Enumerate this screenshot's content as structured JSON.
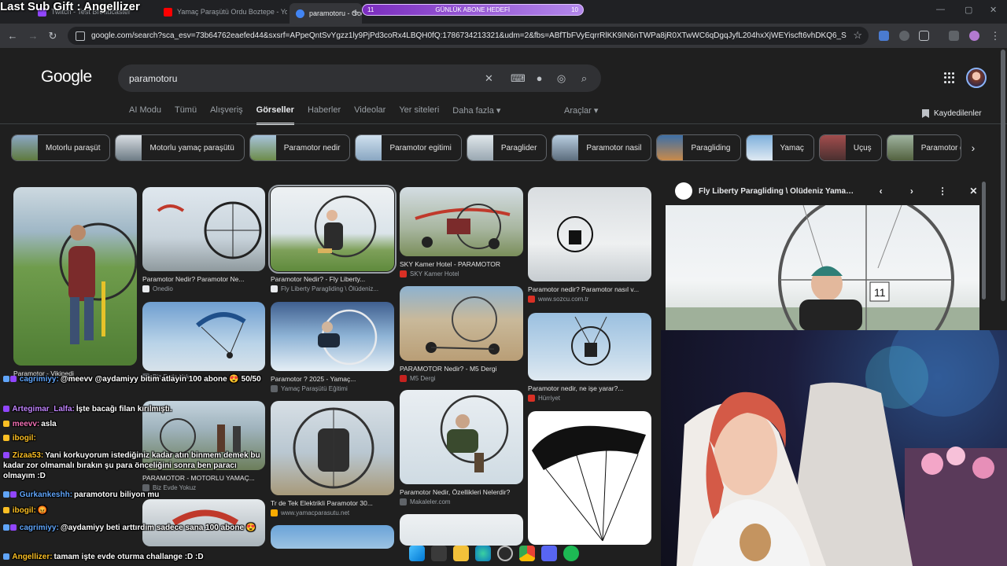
{
  "stream_overlay": {
    "title": "Last Sub Gift : Angellizer",
    "goal_label": "GÜNLÜK ABONE HEDEFİ",
    "goal_current": "11",
    "goal_target": "10"
  },
  "browser": {
    "tabs": [
      {
        "label": "Twitch - Test Broadcaster",
        "color": "#9146ff"
      },
      {
        "label": "Yamaç Paraşütü Ordu Boztepe - Yo",
        "color": "#ff0000"
      },
      {
        "label": "paramotoru - Google Görseller",
        "color": "#4285f4"
      }
    ],
    "close_glyph": "✕",
    "new_tab": "+",
    "url": "google.com/search?sca_esv=73b64762eaefed44&sxsrf=APpeQntSvYgzz1ly9PjPd3coRx4LBQH0fQ:1786734213321&udm=2&fbs=ABfTbFVyEqrrRlKK9IN6nTWPa8jR0XTwWC6qDgqJyfL204hxXjWEYiscft6vhDKQ6_S6oAF..."
  },
  "google": {
    "logo": "Google",
    "query": "paramotoru",
    "nav_tabs": [
      "AI Modu",
      "Tümü",
      "Alışveriş",
      "Görseller",
      "Haberler",
      "Videolar",
      "Yer siteleri",
      "Daha fazla ▾"
    ],
    "active_tab": "Görseller",
    "tools": "Araçlar ▾",
    "saved": "Kaydedilenler",
    "chips": [
      {
        "label": "Motorlu paraşüt",
        "color": "#6b7f55"
      },
      {
        "label": "Motorlu yamaç paraşütü",
        "color": "#8aa3b8"
      },
      {
        "label": "Paramotor nedir",
        "color": "#7e9ab5"
      },
      {
        "label": "Paramotor egitimi",
        "color": "#a9c1d8"
      },
      {
        "label": "Paraglider",
        "color": "#bcc8cf"
      },
      {
        "label": "Paramotor nasil",
        "color": "#8fa6b9"
      },
      {
        "label": "Paragliding",
        "color": "#5b7fa6"
      },
      {
        "label": "Yamaç",
        "color": "#8cb4d6"
      },
      {
        "label": "Uçuş",
        "color": "#7a4b4b"
      },
      {
        "label": "Paramotor g",
        "color": "#6f7d64"
      }
    ],
    "results": [
      {
        "caption": "Paramotor - Vikipedi",
        "source": "",
        "fav": "#ffffff"
      },
      {
        "caption": "Paramotor Nedir? Paramotor Ne...",
        "source": "Onedio",
        "fav": "#e8eaed"
      },
      {
        "caption": "Paramotor Nedir? - Fly Liberty...",
        "source": "Fly Liberty Paragliding \\ Ölüdeniz...",
        "fav": "#e8eaed"
      },
      {
        "caption": "SKY Kamer Hotel - PARAMOTOR",
        "source": "SKY Kamer Hotel",
        "fav": "#d93025"
      },
      {
        "caption": "Paramotor nedir? Paramotor nasıl v...",
        "source": "www.sozcu.com.tr",
        "fav": "#d93025"
      },
      {
        "caption": "PARAMOTOR - MOTORLU YAMAÇ...",
        "source": "Biz Evde Yokuz",
        "fav": "#5f6368"
      },
      {
        "caption": "Paramotor ? 2025 - Yamaç...",
        "source": "Yamaç Paraşütü Eğitimi",
        "fav": "#5f6368"
      },
      {
        "caption": "PARAMOTOR Nedir? - M5 Dergi",
        "source": "M5 Dergi",
        "fav": "#c5221f"
      },
      {
        "caption": "Paramotor nedir, ne işe yarar?...",
        "source": "Hürriyet",
        "fav": "#d93025"
      },
      {
        "caption": "PARAMOTOR - MOTORLU YAMAÇ...",
        "source": "Biz Evde Yokuz",
        "fav": "#5f6368"
      },
      {
        "caption": "Tr de Tek Elektrikli Paramotor 30...",
        "source": "www.yamacparasutu.net",
        "fav": "#f9ab00"
      },
      {
        "caption": "Paramotor Nedir, Özellikleri Nelerdir?",
        "source": "Makaleler.com",
        "fav": "#5f6368"
      }
    ],
    "preview_title": "Fly Liberty Paragliding \\ Ölüdeniz Yamaç ...",
    "preview_prev": "‹",
    "preview_next": "›",
    "preview_more": "⋮",
    "preview_close": "✕"
  },
  "chat": [
    {
      "user": "cagrimiyy:",
      "color": "#60a5fa",
      "text": "@meevv @aydamiyy bitim atlayin 100 abone 😍 50/50"
    },
    {
      "user": "Artegimar_Lalfa:",
      "color": "#c084fc",
      "text": "İşte bacağı filan kırılmıştı."
    },
    {
      "user": "meevv:",
      "color": "#f472b6",
      "text": "asla"
    },
    {
      "user": "ibogil:",
      "color": "#fbbf24",
      "text": ""
    },
    {
      "user": "Zizaa53:",
      "color": "#fbbf24",
      "text": "Yani korkuyorum istediğiniz kadar atın binmem demek bu kadar zor olmamalı bırakın şu para önceliğini sonra ben paracı olmayım :D"
    },
    {
      "user": "Gurkankeshh:",
      "color": "#60a5fa",
      "text": "paramotoru biliyon mu"
    },
    {
      "user": "ibogil:",
      "color": "#fbbf24",
      "text": "😡"
    },
    {
      "user": "cagrimiyy:",
      "color": "#60a5fa",
      "text": "@aydamiyy beti arttırdım sadece sana 100 abone 😍"
    },
    {
      "user": "Angellizer:",
      "color": "#fbbf24",
      "text": "tamam işte evde oturma challange :D :D"
    }
  ]
}
